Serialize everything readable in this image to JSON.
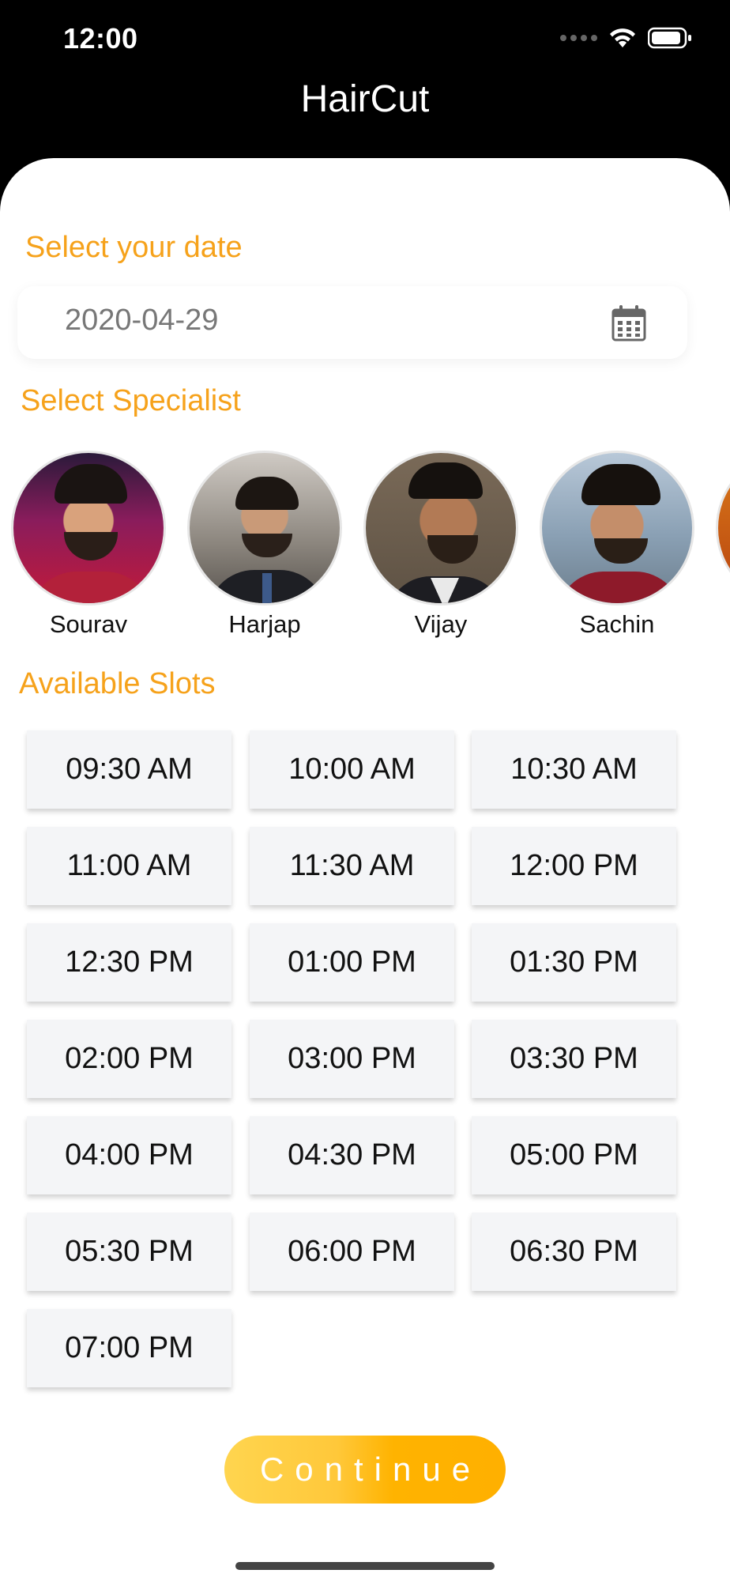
{
  "status_bar": {
    "time": "12:00"
  },
  "nav": {
    "title": "HairCut"
  },
  "date_section": {
    "label": "Select your date",
    "value": "2020-04-29"
  },
  "specialist_section": {
    "label": "Select Specialist",
    "specialists": [
      {
        "name": "Sourav"
      },
      {
        "name": "Harjap"
      },
      {
        "name": "Vijay"
      },
      {
        "name": "Sachin"
      },
      {
        "name": ""
      }
    ]
  },
  "slots_section": {
    "label": "Available Slots",
    "slots": [
      "09:30 AM",
      "10:00 AM",
      "10:30 AM",
      "11:00 AM",
      "11:30 AM",
      "12:00 PM",
      "12:30 PM",
      "01:00 PM",
      "01:30 PM",
      "02:00 PM",
      "03:00 PM",
      "03:30 PM",
      "04:00 PM",
      "04:30 PM",
      "05:00 PM",
      "05:30 PM",
      "06:00 PM",
      "06:30 PM",
      "07:00 PM"
    ]
  },
  "actions": {
    "continue_label": "Continue"
  },
  "colors": {
    "accent": "#f6a21b",
    "button": "#ffb300",
    "slot_bg": "#f4f5f7"
  }
}
